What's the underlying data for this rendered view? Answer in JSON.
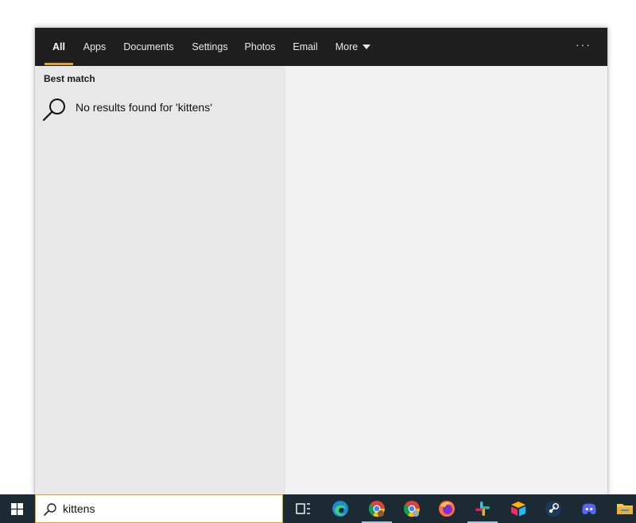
{
  "tabs": [
    {
      "label": "All",
      "active": true
    },
    {
      "label": "Apps",
      "active": false
    },
    {
      "label": "Documents",
      "active": false
    },
    {
      "label": "Settings",
      "active": false
    },
    {
      "label": "Photos",
      "active": false
    },
    {
      "label": "Email",
      "active": false
    },
    {
      "label": "More",
      "active": false
    }
  ],
  "overflow_label": "···",
  "results": {
    "section_title": "Best match",
    "message": "No results found for 'kittens'",
    "icon": "search-icon"
  },
  "search": {
    "value": "kittens",
    "icon": "search-icon"
  },
  "taskbar": {
    "apps": [
      {
        "name": "task-view",
        "icon": "task-view-icon",
        "running": false
      },
      {
        "name": "edge",
        "icon": "edge-icon",
        "running": false
      },
      {
        "name": "chrome-profile-1",
        "icon": "chrome-icon",
        "running": true
      },
      {
        "name": "chrome-profile-2",
        "icon": "chrome-icon",
        "running": false
      },
      {
        "name": "firefox",
        "icon": "firefox-icon",
        "running": false
      },
      {
        "name": "slack",
        "icon": "slack-icon",
        "running": true
      },
      {
        "name": "airtable",
        "icon": "airtable-icon",
        "running": false
      },
      {
        "name": "steam",
        "icon": "steam-icon",
        "running": false
      },
      {
        "name": "discord",
        "icon": "discord-icon",
        "running": false
      },
      {
        "name": "file-explorer",
        "icon": "folder-icon",
        "running": false
      }
    ]
  },
  "colors": {
    "accent": "#d9a61c",
    "tabbar_bg": "#1f1f1f",
    "taskbar_bg": "#1b2a33"
  }
}
